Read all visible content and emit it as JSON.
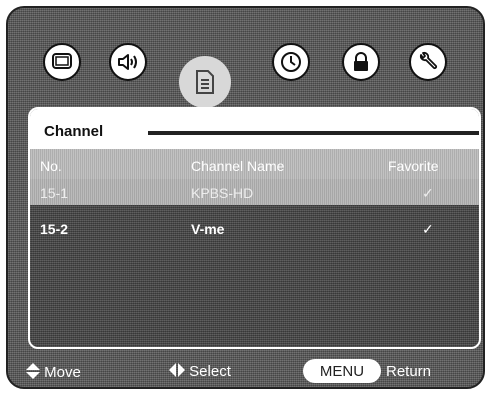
{
  "menu_icons": [
    {
      "name": "picture-icon"
    },
    {
      "name": "audio-icon"
    },
    {
      "name": "channel-list-icon"
    },
    {
      "name": "clock-icon"
    },
    {
      "name": "lock-icon"
    },
    {
      "name": "setup-wrench-icon"
    }
  ],
  "panel": {
    "title": "Channel",
    "columns": {
      "no": "No.",
      "name": "Channel Name",
      "favorite": "Favorite"
    },
    "rows": [
      {
        "no": "15-1",
        "name": "KPBS-HD",
        "favorite": "✓"
      },
      {
        "no": "15-2",
        "name": "V-me",
        "favorite": "✓"
      }
    ]
  },
  "footer": {
    "move": "Move",
    "select": "Select",
    "menu": "MENU",
    "return": "Return"
  },
  "colors": {
    "background": "#555555",
    "header_row": "#bdbdbd",
    "text": "#ffffff"
  }
}
